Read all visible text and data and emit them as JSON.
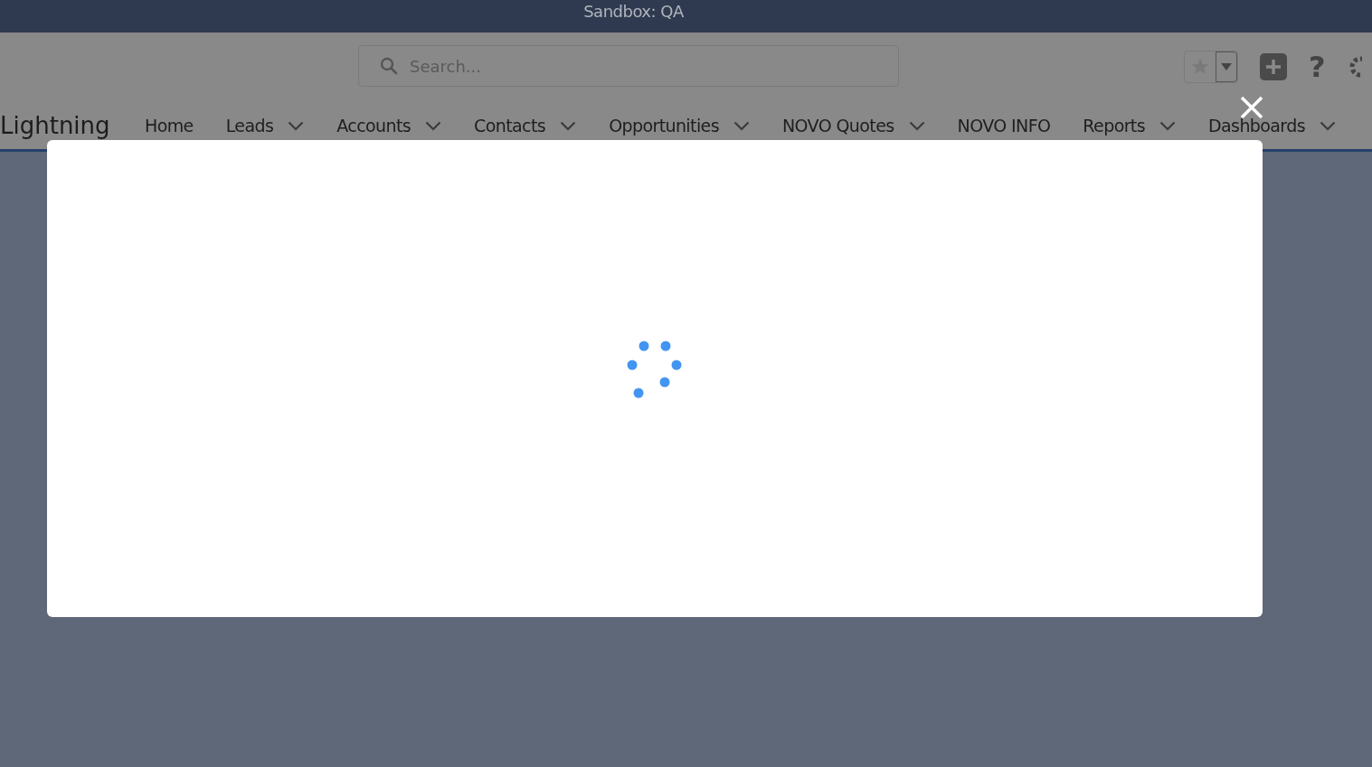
{
  "sandbox_banner": {
    "title": "Sandbox: QA"
  },
  "header": {
    "search": {
      "placeholder": "Search..."
    },
    "help": "?"
  },
  "nav": {
    "app_name": "Lightning",
    "items": [
      {
        "label": "Home",
        "has_menu": false
      },
      {
        "label": "Leads",
        "has_menu": true
      },
      {
        "label": "Accounts",
        "has_menu": true
      },
      {
        "label": "Contacts",
        "has_menu": true
      },
      {
        "label": "Opportunities",
        "has_menu": true
      },
      {
        "label": "NOVO Quotes",
        "has_menu": true
      },
      {
        "label": "NOVO INFO",
        "has_menu": false
      },
      {
        "label": "Reports",
        "has_menu": true
      },
      {
        "label": "Dashboards",
        "has_menu": true
      }
    ]
  },
  "modal": {
    "loading": true
  }
}
